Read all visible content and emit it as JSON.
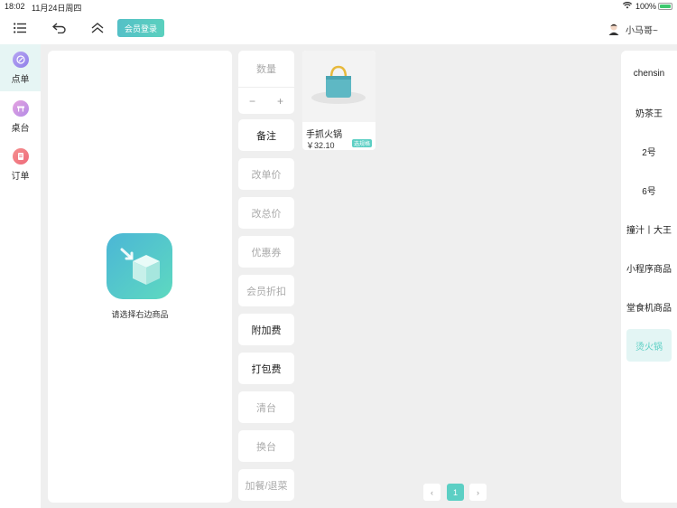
{
  "status_bar": {
    "time": "18:02",
    "date": "11月24日周四",
    "battery": "100%"
  },
  "toolbar": {
    "member_login": "会员登录",
    "user_name": "小马哥~"
  },
  "left_nav": {
    "items": [
      {
        "label": "点单",
        "icon": "order-food-icon",
        "active": true
      },
      {
        "label": "桌台",
        "icon": "table-icon",
        "active": false
      },
      {
        "label": "订单",
        "icon": "receipt-icon",
        "active": false
      }
    ]
  },
  "cart": {
    "empty_text": "请选择右边商品"
  },
  "actions": {
    "quantity": "数量",
    "minus": "−",
    "plus": "+",
    "buttons": [
      {
        "label": "备注",
        "enabled": true
      },
      {
        "label": "改单价",
        "enabled": false
      },
      {
        "label": "改总价",
        "enabled": false
      },
      {
        "label": "优惠券",
        "enabled": false
      },
      {
        "label": "会员折扣",
        "enabled": false
      },
      {
        "label": "附加费",
        "enabled": true
      },
      {
        "label": "打包费",
        "enabled": true
      },
      {
        "label": "清台",
        "enabled": false
      },
      {
        "label": "换台",
        "enabled": false
      },
      {
        "label": "加餐/退菜",
        "enabled": false
      }
    ]
  },
  "products": [
    {
      "name": "手抓火锅",
      "price": "￥32.10",
      "badge": "选规格"
    }
  ],
  "pagination": {
    "current": "1",
    "prev": "‹",
    "next": "›"
  },
  "categories": [
    {
      "label": "chensin",
      "active": false
    },
    {
      "label": "奶茶王",
      "active": false
    },
    {
      "label": "2号",
      "active": false
    },
    {
      "label": "6号",
      "active": false
    },
    {
      "label": "撞汁丨大王",
      "active": false
    },
    {
      "label": "小程序商品",
      "active": false
    },
    {
      "label": "堂食机商品",
      "active": false
    },
    {
      "label": "烫火锅",
      "active": true
    }
  ]
}
